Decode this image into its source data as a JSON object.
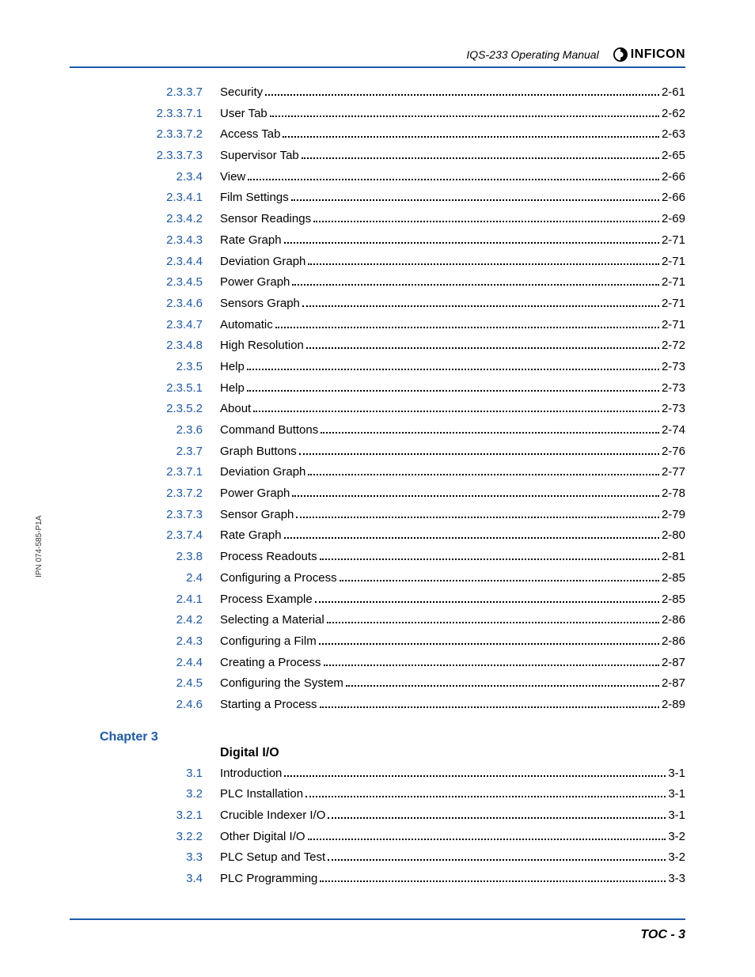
{
  "header": {
    "doc_title": "IQS-233 Operating Manual",
    "brand": "INFICON"
  },
  "spine": "IPN 074-585-P1A",
  "toc": [
    {
      "num": "2.3.3.7",
      "title": "Security",
      "page": "2-61"
    },
    {
      "num": "2.3.3.7.1",
      "title": "User Tab",
      "page": "2-62"
    },
    {
      "num": "2.3.3.7.2",
      "title": "Access Tab",
      "page": "2-63"
    },
    {
      "num": "2.3.3.7.3",
      "title": "Supervisor Tab",
      "page": "2-65"
    },
    {
      "num": "2.3.4",
      "title": "View",
      "page": "2-66"
    },
    {
      "num": "2.3.4.1",
      "title": "Film Settings",
      "page": "2-66"
    },
    {
      "num": "2.3.4.2",
      "title": "Sensor Readings",
      "page": "2-69"
    },
    {
      "num": "2.3.4.3",
      "title": "Rate Graph",
      "page": "2-71"
    },
    {
      "num": "2.3.4.4",
      "title": "Deviation Graph",
      "page": "2-71"
    },
    {
      "num": "2.3.4.5",
      "title": "Power Graph",
      "page": "2-71"
    },
    {
      "num": "2.3.4.6",
      "title": "Sensors Graph",
      "page": "2-71"
    },
    {
      "num": "2.3.4.7",
      "title": "Automatic",
      "page": "2-71"
    },
    {
      "num": "2.3.4.8",
      "title": "High Resolution",
      "page": "2-72"
    },
    {
      "num": "2.3.5",
      "title": "Help",
      "page": "2-73"
    },
    {
      "num": "2.3.5.1",
      "title": "Help",
      "page": "2-73"
    },
    {
      "num": "2.3.5.2",
      "title": "About",
      "page": "2-73"
    },
    {
      "num": "2.3.6",
      "title": "Command Buttons",
      "page": "2-74"
    },
    {
      "num": "2.3.7",
      "title": "Graph Buttons",
      "page": "2-76"
    },
    {
      "num": "2.3.7.1",
      "title": "Deviation Graph",
      "page": "2-77"
    },
    {
      "num": "2.3.7.2",
      "title": "Power Graph",
      "page": "2-78"
    },
    {
      "num": "2.3.7.3",
      "title": "Sensor Graph",
      "page": "2-79"
    },
    {
      "num": "2.3.7.4",
      "title": "Rate Graph",
      "page": "2-80"
    },
    {
      "num": "2.3.8",
      "title": "Process Readouts",
      "page": "2-81"
    },
    {
      "num": "2.4",
      "title": "Configuring a Process",
      "page": "2-85"
    },
    {
      "num": "2.4.1",
      "title": "Process Example",
      "page": "2-85"
    },
    {
      "num": "2.4.2",
      "title": "Selecting a Material",
      "page": "2-86"
    },
    {
      "num": "2.4.3",
      "title": "Configuring a Film",
      "page": "2-86"
    },
    {
      "num": "2.4.4",
      "title": "Creating a Process",
      "page": "2-87"
    },
    {
      "num": "2.4.5",
      "title": "Configuring the System",
      "page": "2-87"
    },
    {
      "num": "2.4.6",
      "title": "Starting a Process",
      "page": "2-89"
    }
  ],
  "chapter3": {
    "label": "Chapter 3",
    "title": "Digital I/O",
    "entries": [
      {
        "num": "3.1",
        "title": "Introduction",
        "page": "3-1"
      },
      {
        "num": "3.2",
        "title": "PLC Installation",
        "page": "3-1"
      },
      {
        "num": "3.2.1",
        "title": "Crucible Indexer I/O",
        "page": "3-1"
      },
      {
        "num": "3.2.2",
        "title": "Other Digital I/O",
        "page": "3-2"
      },
      {
        "num": "3.3",
        "title": "PLC Setup and Test",
        "page": "3-2"
      },
      {
        "num": "3.4",
        "title": "PLC Programming",
        "page": "3-3"
      }
    ]
  },
  "footer": "TOC - 3"
}
